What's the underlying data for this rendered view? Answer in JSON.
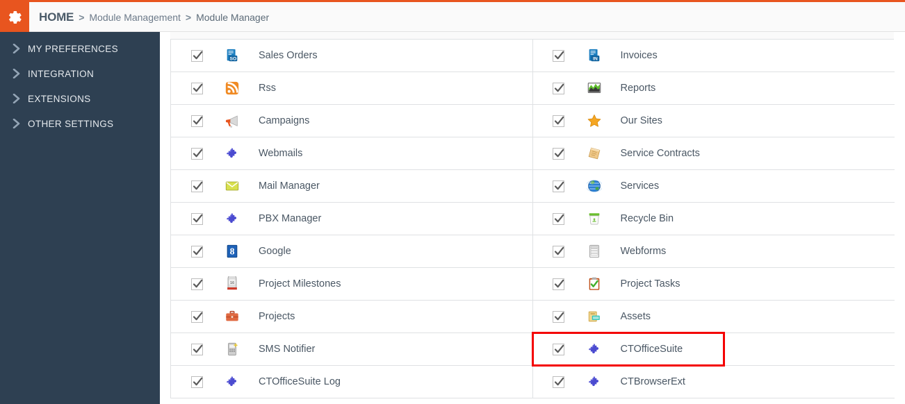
{
  "theme": {
    "accent_orange": "#e8551f",
    "sidebar_bg": "#2e4052",
    "header_bg": "#fafafa",
    "highlight_red": "#f40000",
    "text_color": "#4a5764"
  },
  "header": {
    "gear_icon": "gear-icon",
    "breadcrumb": {
      "home": "HOME",
      "separator": ">",
      "items": [
        {
          "label": "Module Management"
        },
        {
          "label": "Module Manager"
        }
      ]
    }
  },
  "sidebar": {
    "items": [
      {
        "label": "MY PREFERENCES",
        "icon": "chevron-right-icon"
      },
      {
        "label": "INTEGRATION",
        "icon": "chevron-right-icon"
      },
      {
        "label": "EXTENSIONS",
        "icon": "chevron-right-icon"
      },
      {
        "label": "OTHER SETTINGS",
        "icon": "chevron-right-icon"
      }
    ]
  },
  "main": {
    "highlight": {
      "target_module": "CTOfficeSuite",
      "color": "#f40000"
    },
    "columns": [
      {
        "side": "left",
        "rows": [
          {
            "label": "Sales Orders",
            "checked": true,
            "icon": "sales-order-document-icon"
          },
          {
            "label": "Rss",
            "checked": true,
            "icon": "rss-feed-icon"
          },
          {
            "label": "Campaigns",
            "checked": true,
            "icon": "megaphone-icon"
          },
          {
            "label": "Webmails",
            "checked": true,
            "icon": "puzzle-piece-icon"
          },
          {
            "label": "Mail Manager",
            "checked": true,
            "icon": "envelope-icon"
          },
          {
            "label": "PBX Manager",
            "checked": true,
            "icon": "puzzle-piece-icon"
          },
          {
            "label": "Google",
            "checked": true,
            "icon": "google-g-icon"
          },
          {
            "label": "Project Milestones",
            "checked": true,
            "icon": "milestone-calendar-icon"
          },
          {
            "label": "Projects",
            "checked": true,
            "icon": "briefcase-icon"
          },
          {
            "label": "SMS Notifier",
            "checked": true,
            "icon": "mobile-phone-icon"
          },
          {
            "label": "CTOfficeSuite Log",
            "checked": true,
            "icon": "puzzle-piece-icon"
          }
        ]
      },
      {
        "side": "right",
        "rows": [
          {
            "label": "Invoices",
            "checked": true,
            "icon": "invoice-document-icon"
          },
          {
            "label": "Reports",
            "checked": true,
            "icon": "chart-report-icon"
          },
          {
            "label": "Our Sites",
            "checked": true,
            "icon": "star-icon"
          },
          {
            "label": "Service Contracts",
            "checked": true,
            "icon": "scroll-contract-icon"
          },
          {
            "label": "Services",
            "checked": true,
            "icon": "globe-icon"
          },
          {
            "label": "Recycle Bin",
            "checked": true,
            "icon": "recycle-bin-icon"
          },
          {
            "label": "Webforms",
            "checked": true,
            "icon": "webform-lines-icon"
          },
          {
            "label": "Project Tasks",
            "checked": true,
            "icon": "clipboard-check-icon"
          },
          {
            "label": "Assets",
            "checked": true,
            "icon": "assets-box-icon"
          },
          {
            "label": "CTOfficeSuite",
            "checked": true,
            "icon": "puzzle-piece-icon"
          },
          {
            "label": "CTBrowserExt",
            "checked": true,
            "icon": "puzzle-piece-icon"
          }
        ]
      }
    ]
  }
}
